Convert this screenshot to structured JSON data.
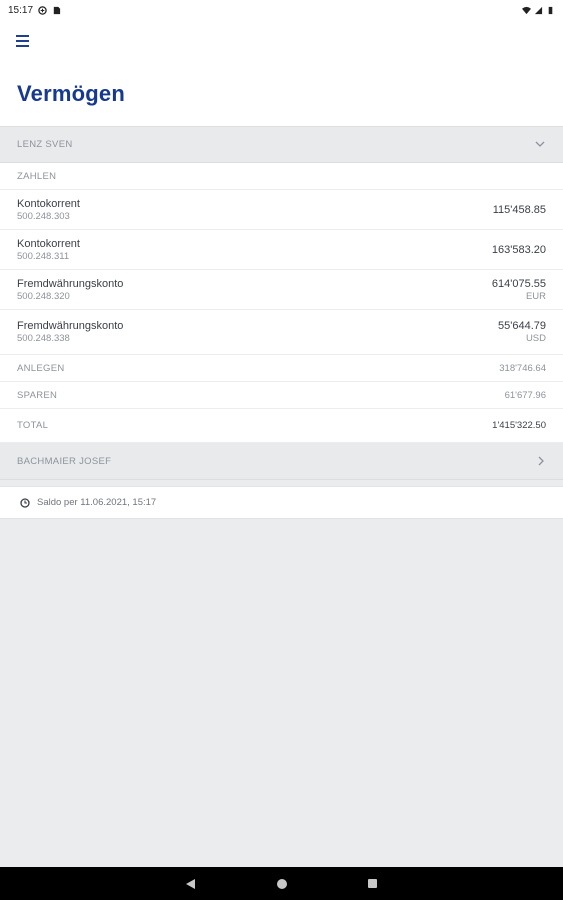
{
  "status_bar": {
    "time": "15:17"
  },
  "header": {
    "title": "Vermögen"
  },
  "owners": [
    {
      "name": "LENZ SVEN",
      "section_label": "ZAHLEN",
      "accounts": [
        {
          "name": "Kontokorrent",
          "number": "500.248.303",
          "amount": "115'458.85",
          "currency": ""
        },
        {
          "name": "Kontokorrent",
          "number": "500.248.311",
          "amount": "163'583.20",
          "currency": ""
        },
        {
          "name": "Fremdwährungskonto",
          "number": "500.248.320",
          "amount": "614'075.55",
          "currency": "EUR"
        },
        {
          "name": "Fremdwährungskonto",
          "number": "500.248.338",
          "amount": "55'644.79",
          "currency": "USD"
        }
      ],
      "summary": [
        {
          "label": "ANLEGEN",
          "value": "318'746.64"
        },
        {
          "label": "SPAREN",
          "value": "61'677.96"
        },
        {
          "label": "TOTAL",
          "value": "1'415'322.50"
        }
      ]
    },
    {
      "name": "BACHMAIER JOSEF"
    }
  ],
  "saldo": {
    "text": "Saldo per 11.06.2021, 15:17"
  },
  "icons": {
    "menu": "hamburger-icon",
    "expand": "chevron-down-icon",
    "navigate": "chevron-right-icon",
    "time": "clock-icon",
    "back": "back-triangle-icon",
    "home": "home-circle-icon",
    "recents": "recents-square-icon"
  },
  "colors": {
    "brand": "#173a8f",
    "background": "#ebecee",
    "header_band": "#e9eaec"
  }
}
